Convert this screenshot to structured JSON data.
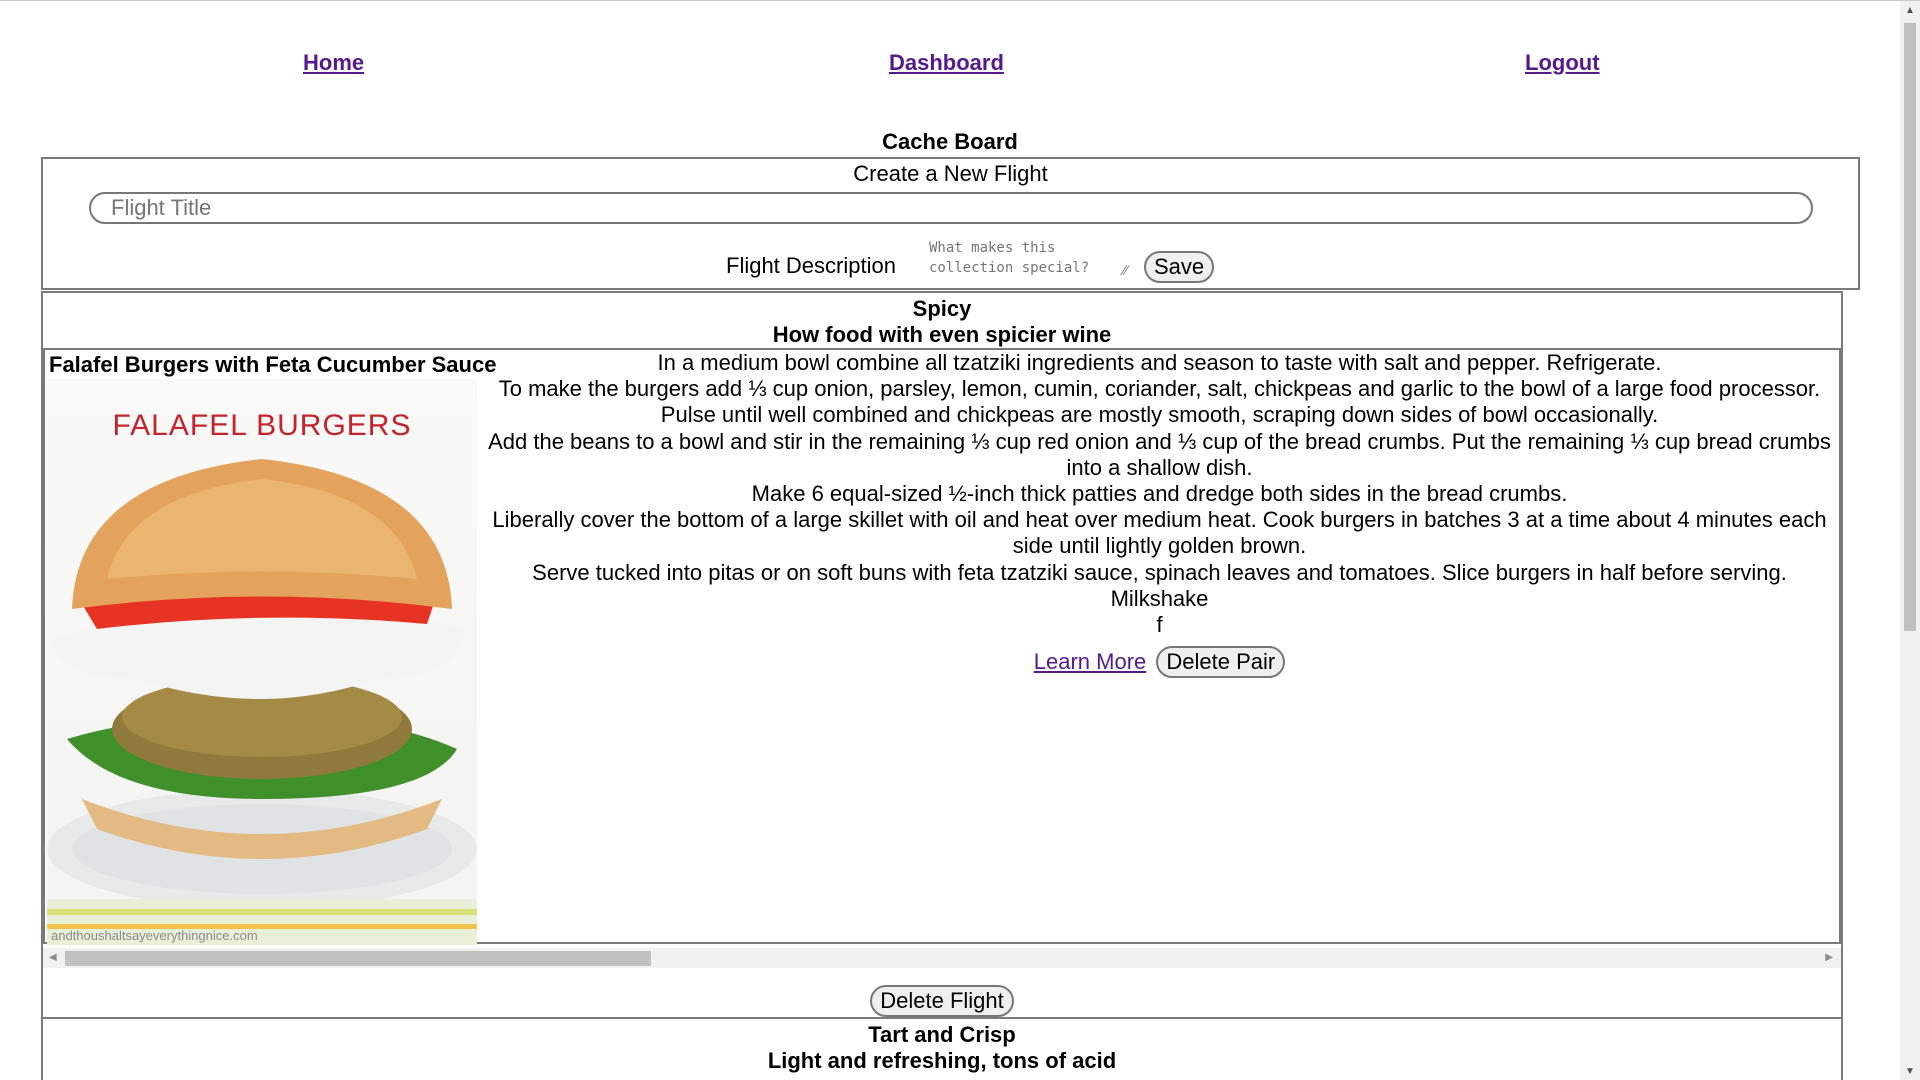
{
  "nav": {
    "home": "Home",
    "dashboard": "Dashboard",
    "logout": "Logout"
  },
  "board": {
    "title": "Cache Board"
  },
  "create_form": {
    "heading": "Create a New Flight",
    "title_placeholder": "Flight Title",
    "description_label": "Flight Description",
    "description_placeholder": "What makes this collection special?",
    "save_label": "Save"
  },
  "flights": [
    {
      "name": "Spicy",
      "description": "How food with even spicier wine",
      "pairs": [
        {
          "food_name": "Falafel Burgers with Feta Cucumber Sauce",
          "image_caption": "FALAFEL BURGERS",
          "image_watermark": "andthoushaltsayeverythingnice.com",
          "steps": [
            "In a medium bowl combine all tzatziki ingredients and season to taste with salt and pepper. Refrigerate.",
            "To make the burgers add ⅓ cup onion, parsley, lemon, cumin, coriander, salt, chickpeas and garlic to the bowl of a large food processor. Pulse until well combined and chickpeas are mostly smooth, scraping down sides of bowl occasionally.",
            "Add the beans to a bowl and stir in the remaining ⅓ cup red onion and ⅓ cup of the bread crumbs. Put the remaining ⅓ cup bread crumbs into a shallow dish.",
            "Make 6 equal-sized ½-inch thick patties and dredge both sides in the bread crumbs.",
            "Liberally cover the bottom of a large skillet with oil and heat over medium heat. Cook burgers in batches 3 at a time about 4 minutes each side until lightly golden brown.",
            "Serve tucked into pitas or on soft buns with feta tzatziki sauce, spinach leaves and tomatoes. Slice burgers in half before serving."
          ],
          "drink_name": "Milkshake",
          "drink_note": "f",
          "learn_more_label": "Learn More",
          "delete_pair_label": "Delete Pair"
        }
      ],
      "delete_flight_label": "Delete Flight"
    },
    {
      "name": "Tart and Crisp",
      "description": "Light and refreshing, tons of acid"
    }
  ]
}
